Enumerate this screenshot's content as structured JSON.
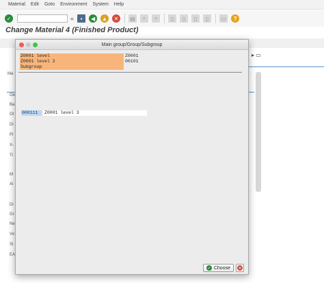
{
  "menu": [
    "Material",
    "Edit",
    "Goto",
    "Environment",
    "System",
    "Help"
  ],
  "page_title": "Change Material 4 (Finished Product)",
  "background_letters": [
    "Ma",
    "Ge",
    "Ba",
    "Ol",
    "Di",
    "Pi",
    "X-",
    "Ti",
    "M",
    "Ai",
    "Di",
    "Gr",
    "Ne",
    "Vo",
    "Si",
    "EA"
  ],
  "dialog": {
    "title": "Main group/Group/Subgroup",
    "hierarchy": [
      {
        "label": "Z0001 level",
        "value": "Z0001"
      },
      {
        "label": "Z0001 level 2",
        "value": "00101"
      },
      {
        "label": "Subgroup",
        "value": ""
      }
    ],
    "selected_row": {
      "code": "000111",
      "description": "Z0001 level 3"
    },
    "buttons": {
      "choose": "Choose"
    }
  },
  "colors": {
    "highlight": "#f7b57c",
    "selection": "#bcd7f1",
    "ok_green": "#2a8b3a",
    "cancel_red": "#d34b3d"
  },
  "icons": {
    "enter": "check-icon",
    "save": "save-icon",
    "back": "back-icon",
    "exit": "exit-icon",
    "cancel": "cancel-icon",
    "help": "help-icon"
  }
}
